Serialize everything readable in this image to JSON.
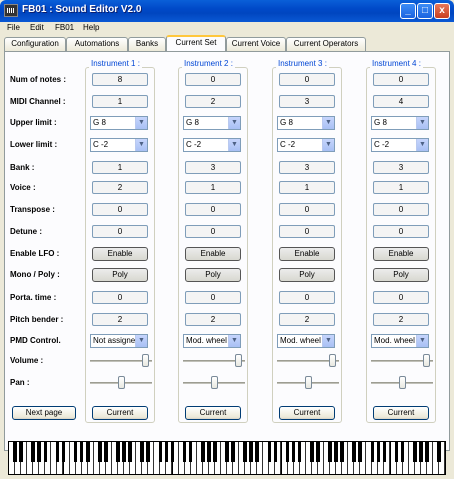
{
  "window": {
    "title": "FB01 : Sound Editor V2.0",
    "app_icon": "keyboard-icon"
  },
  "title_buttons": {
    "minimize": "_",
    "maximize": "□",
    "close": "x"
  },
  "menu": [
    "File",
    "Edit",
    "FB01",
    "Help"
  ],
  "tabs": [
    "Configuration",
    "Automations",
    "Banks",
    "Current Set",
    "Current Voice",
    "Current Operators"
  ],
  "active_tab": "Current Set",
  "row_labels": [
    "Num of notes :",
    "MIDI Channel :",
    "Upper limit :",
    "Lower limit :",
    "Bank :",
    "Voice :",
    "Transpose :",
    "Detune :",
    "Enable LFO :",
    "Mono / Poly :",
    "Porta. time :",
    "Pitch bender :",
    "PMD Control.",
    "Volume :",
    "Pan :"
  ],
  "instruments": [
    {
      "label": "Instrument 1 :",
      "num_notes": "8",
      "midi_channel": "1",
      "upper_limit": "G 8",
      "lower_limit": "C -2",
      "bank": "1",
      "voice": "2",
      "transpose": "0",
      "detune": "0",
      "lfo": "Enable",
      "mono_poly": "Poly",
      "porta_time": "0",
      "pitch_bender": "2",
      "pmd_control": "Not assignec",
      "volume_level": 0.95,
      "pan_level": 0.5,
      "button": "Current"
    },
    {
      "label": "Instrument 2 :",
      "num_notes": "0",
      "midi_channel": "2",
      "upper_limit": "G 8",
      "lower_limit": "C -2",
      "bank": "3",
      "voice": "1",
      "transpose": "0",
      "detune": "0",
      "lfo": "Enable",
      "mono_poly": "Poly",
      "porta_time": "0",
      "pitch_bender": "2",
      "pmd_control": "Mod. wheel",
      "volume_level": 0.95,
      "pan_level": 0.5,
      "button": "Current"
    },
    {
      "label": "Instrument 3 :",
      "num_notes": "0",
      "midi_channel": "3",
      "upper_limit": "G 8",
      "lower_limit": "C -2",
      "bank": "3",
      "voice": "1",
      "transpose": "0",
      "detune": "0",
      "lfo": "Enable",
      "mono_poly": "Poly",
      "porta_time": "0",
      "pitch_bender": "2",
      "pmd_control": "Mod. wheel",
      "volume_level": 0.95,
      "pan_level": 0.5,
      "button": "Current"
    },
    {
      "label": "Instrument 4 :",
      "num_notes": "0",
      "midi_channel": "4",
      "upper_limit": "G 8",
      "lower_limit": "C -2",
      "bank": "3",
      "voice": "1",
      "transpose": "0",
      "detune": "0",
      "lfo": "Enable",
      "mono_poly": "Poly",
      "porta_time": "0",
      "pitch_bender": "2",
      "pmd_control": "Mod. wheel",
      "volume_level": 0.95,
      "pan_level": 0.5,
      "button": "Current"
    }
  ],
  "next_page_label": "Next page",
  "colors": {
    "titlebar": "#0a5fd8",
    "group_label": "#0046d5",
    "active_tab_accent": "#ffc73c"
  }
}
